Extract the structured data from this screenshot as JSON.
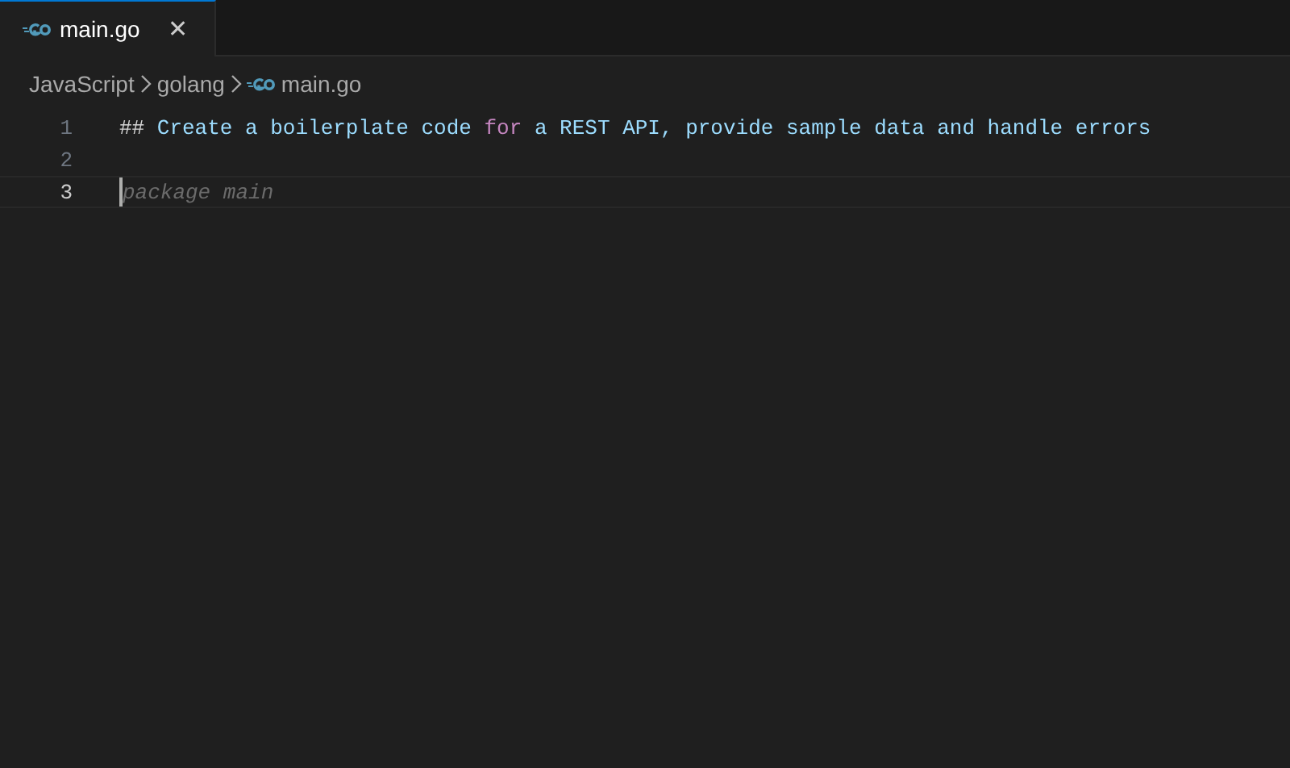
{
  "tabs": [
    {
      "label": "main.go",
      "selected": true,
      "close": "✕"
    }
  ],
  "breadcrumbs": [
    "JavaScript",
    "golang",
    "main.go"
  ],
  "lines": [
    {
      "number": "1",
      "current": false,
      "tokens": [
        {
          "kind": "plain",
          "text": "## "
        },
        {
          "kind": "comment",
          "text": "Create a boilerplate code "
        },
        {
          "kind": "keyword",
          "text": "for"
        },
        {
          "kind": "comment",
          "text": " a REST API, provide sample data and handle errors"
        }
      ]
    },
    {
      "number": "2",
      "current": false
    },
    {
      "number": "3",
      "current": true,
      "placeholder": "package main"
    }
  ]
}
